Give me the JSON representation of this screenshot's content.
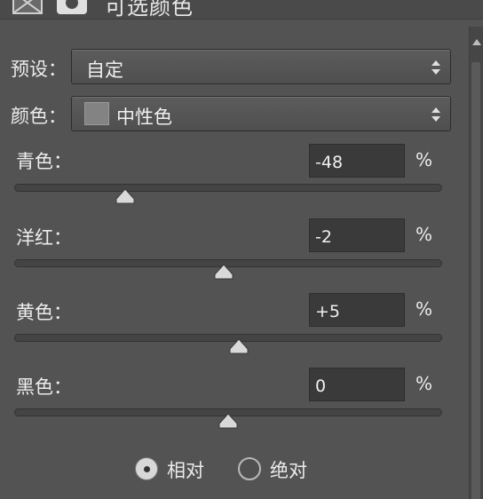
{
  "header": {
    "title": "可选颜色",
    "icon_adjustment": "selective-color-layer-icon",
    "icon_mask": "layer-mask-icon"
  },
  "preset": {
    "label": "预设：",
    "value": "自定"
  },
  "colors": {
    "label": "颜色：",
    "value": "中性色",
    "swatch_color": "#838383"
  },
  "sliders": [
    {
      "label": "青色：",
      "value": "-48",
      "unit": "%",
      "level": -48
    },
    {
      "label": "洋红：",
      "value": "-2",
      "unit": "%",
      "level": -2
    },
    {
      "label": "黄色：",
      "value": "+5",
      "unit": "%",
      "level": 5
    },
    {
      "label": "黑色：",
      "value": "0",
      "unit": "%",
      "level": 0
    }
  ],
  "method": {
    "options": [
      {
        "label": "相对",
        "checked": true
      },
      {
        "label": "绝对",
        "checked": false
      }
    ]
  }
}
